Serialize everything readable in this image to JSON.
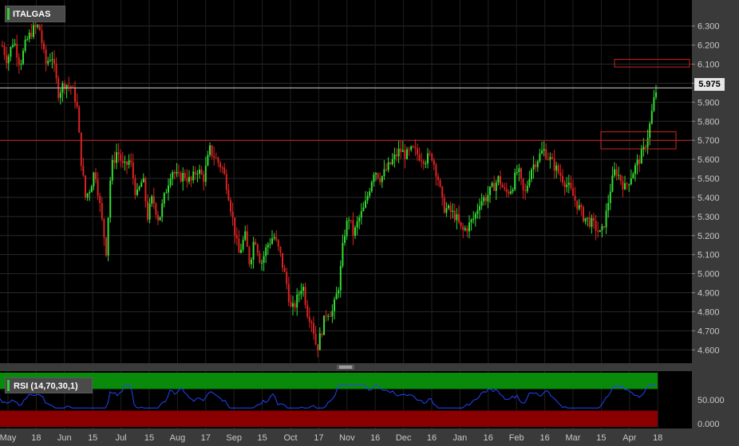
{
  "chart_data": {
    "type": "candlestick",
    "title": "ITALGAS",
    "last_price": "5.975",
    "y_ticks": [
      "6.300",
      "6.200",
      "6.100",
      "6.000",
      "5.900",
      "5.800",
      "5.700",
      "5.600",
      "5.500",
      "5.400",
      "5.300",
      "5.200",
      "5.100",
      "5.000",
      "4.900",
      "4.800",
      "4.700",
      "4.600"
    ],
    "x_ticks": [
      "May",
      "18",
      "Jun",
      "15",
      "Jul",
      "15",
      "Aug",
      "17",
      "Sep",
      "15",
      "Oct",
      "17",
      "Nov",
      "16",
      "Dec",
      "16",
      "Jan",
      "16",
      "Feb",
      "16",
      "Mar",
      "15",
      "Apr",
      "18"
    ],
    "ylim": [
      4.53,
      6.42
    ],
    "horizontal_line": 5.7,
    "zones": [
      {
        "low": 6.085,
        "high": 6.125
      },
      {
        "low": 5.655,
        "high": 5.745
      }
    ],
    "close_path": [
      [
        0,
        6.22
      ],
      [
        8,
        6.12
      ],
      [
        16,
        6.23
      ],
      [
        24,
        6.1
      ],
      [
        32,
        6.22
      ],
      [
        40,
        6.28
      ],
      [
        48,
        6.3
      ],
      [
        56,
        6.1
      ],
      [
        64,
        6.15
      ],
      [
        72,
        5.95
      ],
      [
        80,
        6.0
      ],
      [
        88,
        5.98
      ],
      [
        95,
        5.9
      ],
      [
        100,
        5.62
      ],
      [
        106,
        5.4
      ],
      [
        112,
        5.45
      ],
      [
        118,
        5.55
      ],
      [
        126,
        5.3
      ],
      [
        132,
        5.12
      ],
      [
        138,
        5.55
      ],
      [
        146,
        5.65
      ],
      [
        154,
        5.55
      ],
      [
        162,
        5.6
      ],
      [
        170,
        5.4
      ],
      [
        178,
        5.5
      ],
      [
        184,
        5.3
      ],
      [
        190,
        5.4
      ],
      [
        198,
        5.28
      ],
      [
        206,
        5.42
      ],
      [
        214,
        5.55
      ],
      [
        222,
        5.5
      ],
      [
        230,
        5.52
      ],
      [
        238,
        5.48
      ],
      [
        246,
        5.55
      ],
      [
        254,
        5.5
      ],
      [
        262,
        5.65
      ],
      [
        270,
        5.6
      ],
      [
        278,
        5.55
      ],
      [
        284,
        5.45
      ],
      [
        290,
        5.3
      ],
      [
        298,
        5.1
      ],
      [
        306,
        5.2
      ],
      [
        312,
        5.05
      ],
      [
        318,
        5.2
      ],
      [
        326,
        5.05
      ],
      [
        334,
        5.15
      ],
      [
        342,
        5.2
      ],
      [
        350,
        5.1
      ],
      [
        358,
        4.95
      ],
      [
        364,
        4.8
      ],
      [
        370,
        4.85
      ],
      [
        378,
        4.95
      ],
      [
        384,
        4.8
      ],
      [
        390,
        4.75
      ],
      [
        396,
        4.6
      ],
      [
        402,
        4.7
      ],
      [
        408,
        4.8
      ],
      [
        416,
        4.8
      ],
      [
        424,
        4.95
      ],
      [
        430,
        5.2
      ],
      [
        436,
        5.3
      ],
      [
        442,
        5.2
      ],
      [
        448,
        5.28
      ],
      [
        456,
        5.35
      ],
      [
        462,
        5.45
      ],
      [
        468,
        5.55
      ],
      [
        476,
        5.5
      ],
      [
        484,
        5.55
      ],
      [
        492,
        5.6
      ],
      [
        500,
        5.65
      ],
      [
        508,
        5.62
      ],
      [
        516,
        5.65
      ],
      [
        524,
        5.62
      ],
      [
        532,
        5.6
      ],
      [
        540,
        5.62
      ],
      [
        548,
        5.5
      ],
      [
        554,
        5.35
      ],
      [
        562,
        5.33
      ],
      [
        570,
        5.3
      ],
      [
        578,
        5.22
      ],
      [
        586,
        5.25
      ],
      [
        594,
        5.3
      ],
      [
        600,
        5.38
      ],
      [
        608,
        5.4
      ],
      [
        616,
        5.45
      ],
      [
        624,
        5.5
      ],
      [
        632,
        5.42
      ],
      [
        640,
        5.45
      ],
      [
        648,
        5.55
      ],
      [
        656,
        5.4
      ],
      [
        664,
        5.55
      ],
      [
        672,
        5.6
      ],
      [
        680,
        5.65
      ],
      [
        688,
        5.6
      ],
      [
        696,
        5.55
      ],
      [
        704,
        5.5
      ],
      [
        712,
        5.45
      ],
      [
        718,
        5.4
      ],
      [
        724,
        5.35
      ],
      [
        730,
        5.3
      ],
      [
        736,
        5.28
      ],
      [
        744,
        5.25
      ],
      [
        752,
        5.2
      ],
      [
        758,
        5.3
      ],
      [
        764,
        5.45
      ],
      [
        770,
        5.55
      ],
      [
        776,
        5.5
      ],
      [
        782,
        5.45
      ],
      [
        788,
        5.5
      ],
      [
        794,
        5.55
      ],
      [
        800,
        5.6
      ],
      [
        806,
        5.65
      ],
      [
        812,
        5.75
      ],
      [
        816,
        5.85
      ],
      [
        820,
        5.95
      ],
      [
        823,
        5.975
      ]
    ],
    "rsi": {
      "label": "RSI (14,70,30,1)",
      "overbought": 70,
      "oversold": 30,
      "ticks": [
        "50.000",
        "0.000"
      ]
    }
  }
}
